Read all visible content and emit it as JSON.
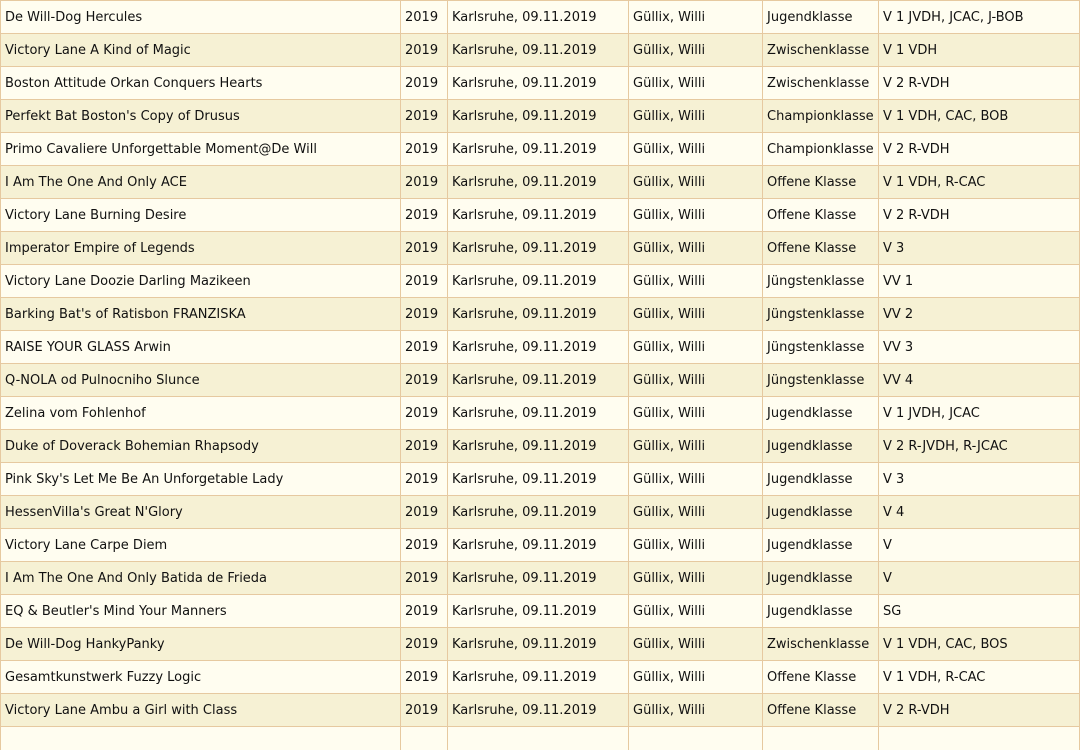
{
  "colors": {
    "row_odd": "#fffdf0",
    "row_even": "#f6f1d4",
    "border": "#e6c9a0"
  },
  "rows": [
    {
      "name": "De Will-Dog Hercules",
      "year": "2019",
      "place": "Karlsruhe, 09.11.2019",
      "judge": "Güllix, Willi",
      "class": "Jugendklasse",
      "result": "V 1 JVDH, JCAC, J-BOB"
    },
    {
      "name": "Victory Lane A Kind of Magic",
      "year": "2019",
      "place": "Karlsruhe, 09.11.2019",
      "judge": "Güllix, Willi",
      "class": "Zwischenklasse",
      "result": "V 1 VDH"
    },
    {
      "name": "Boston Attitude Orkan Conquers Hearts",
      "year": "2019",
      "place": "Karlsruhe, 09.11.2019",
      "judge": "Güllix, Willi",
      "class": "Zwischenklasse",
      "result": "V 2 R-VDH"
    },
    {
      "name": "Perfekt Bat Boston's Copy of Drusus",
      "year": "2019",
      "place": "Karlsruhe, 09.11.2019",
      "judge": "Güllix, Willi",
      "class": "Championklasse",
      "result": "V 1 VDH, CAC, BOB"
    },
    {
      "name": "Primo Cavaliere Unforgettable Moment@De Will",
      "year": "2019",
      "place": "Karlsruhe, 09.11.2019",
      "judge": "Güllix, Willi",
      "class": "Championklasse",
      "result": "V 2 R-VDH"
    },
    {
      "name": "I Am The One And Only ACE",
      "year": "2019",
      "place": "Karlsruhe, 09.11.2019",
      "judge": "Güllix, Willi",
      "class": "Offene Klasse",
      "result": "V 1 VDH, R-CAC"
    },
    {
      "name": "Victory Lane Burning Desire",
      "year": "2019",
      "place": "Karlsruhe, 09.11.2019",
      "judge": "Güllix, Willi",
      "class": "Offene Klasse",
      "result": "V 2 R-VDH"
    },
    {
      "name": "Imperator Empire of Legends",
      "year": "2019",
      "place": "Karlsruhe, 09.11.2019",
      "judge": "Güllix, Willi",
      "class": "Offene Klasse",
      "result": "V 3"
    },
    {
      "name": "Victory Lane Doozie Darling Mazikeen",
      "year": "2019",
      "place": "Karlsruhe, 09.11.2019",
      "judge": "Güllix, Willi",
      "class": "Jüngstenklasse",
      "result": "VV 1"
    },
    {
      "name": "Barking Bat's of Ratisbon FRANZISKA",
      "year": "2019",
      "place": "Karlsruhe, 09.11.2019",
      "judge": "Güllix, Willi",
      "class": "Jüngstenklasse",
      "result": "VV 2"
    },
    {
      "name": "RAISE YOUR GLASS Arwin",
      "year": "2019",
      "place": "Karlsruhe, 09.11.2019",
      "judge": "Güllix, Willi",
      "class": "Jüngstenklasse",
      "result": "VV 3"
    },
    {
      "name": "Q-NOLA od Pulnocniho Slunce",
      "year": "2019",
      "place": "Karlsruhe, 09.11.2019",
      "judge": "Güllix, Willi",
      "class": "Jüngstenklasse",
      "result": "VV 4"
    },
    {
      "name": "Zelina vom Fohlenhof",
      "year": "2019",
      "place": "Karlsruhe, 09.11.2019",
      "judge": "Güllix, Willi",
      "class": "Jugendklasse",
      "result": "V 1 JVDH, JCAC"
    },
    {
      "name": "Duke of Doverack Bohemian Rhapsody",
      "year": "2019",
      "place": "Karlsruhe, 09.11.2019",
      "judge": "Güllix, Willi",
      "class": "Jugendklasse",
      "result": "V 2 R-JVDH, R-JCAC"
    },
    {
      "name": "Pink Sky's Let Me Be An Unforgetable Lady",
      "year": "2019",
      "place": "Karlsruhe, 09.11.2019",
      "judge": "Güllix, Willi",
      "class": "Jugendklasse",
      "result": "V 3"
    },
    {
      "name": "HessenVilla's Great N'Glory",
      "year": "2019",
      "place": "Karlsruhe, 09.11.2019",
      "judge": "Güllix, Willi",
      "class": "Jugendklasse",
      "result": "V 4"
    },
    {
      "name": "Victory Lane Carpe Diem",
      "year": "2019",
      "place": "Karlsruhe, 09.11.2019",
      "judge": "Güllix, Willi",
      "class": "Jugendklasse",
      "result": "V"
    },
    {
      "name": "I Am The One And Only Batida de Frieda",
      "year": "2019",
      "place": "Karlsruhe, 09.11.2019",
      "judge": "Güllix, Willi",
      "class": "Jugendklasse",
      "result": "V"
    },
    {
      "name": "EQ & Beutler's Mind Your Manners",
      "year": "2019",
      "place": "Karlsruhe, 09.11.2019",
      "judge": "Güllix, Willi",
      "class": "Jugendklasse",
      "result": "SG"
    },
    {
      "name": "De Will-Dog HankyPanky",
      "year": "2019",
      "place": "Karlsruhe, 09.11.2019",
      "judge": "Güllix, Willi",
      "class": "Zwischenklasse",
      "result": "V 1 VDH, CAC, BOS"
    },
    {
      "name": "Gesamtkunstwerk Fuzzy Logic",
      "year": "2019",
      "place": "Karlsruhe, 09.11.2019",
      "judge": "Güllix, Willi",
      "class": "Offene Klasse",
      "result": "V 1 VDH, R-CAC"
    },
    {
      "name": "Victory Lane Ambu a Girl with Class",
      "year": "2019",
      "place": "Karlsruhe, 09.11.2019",
      "judge": "Güllix, Willi",
      "class": "Offene Klasse",
      "result": "V 2 R-VDH"
    },
    {
      "name": "",
      "year": "",
      "place": "",
      "judge": "",
      "class": "",
      "result": ""
    }
  ]
}
